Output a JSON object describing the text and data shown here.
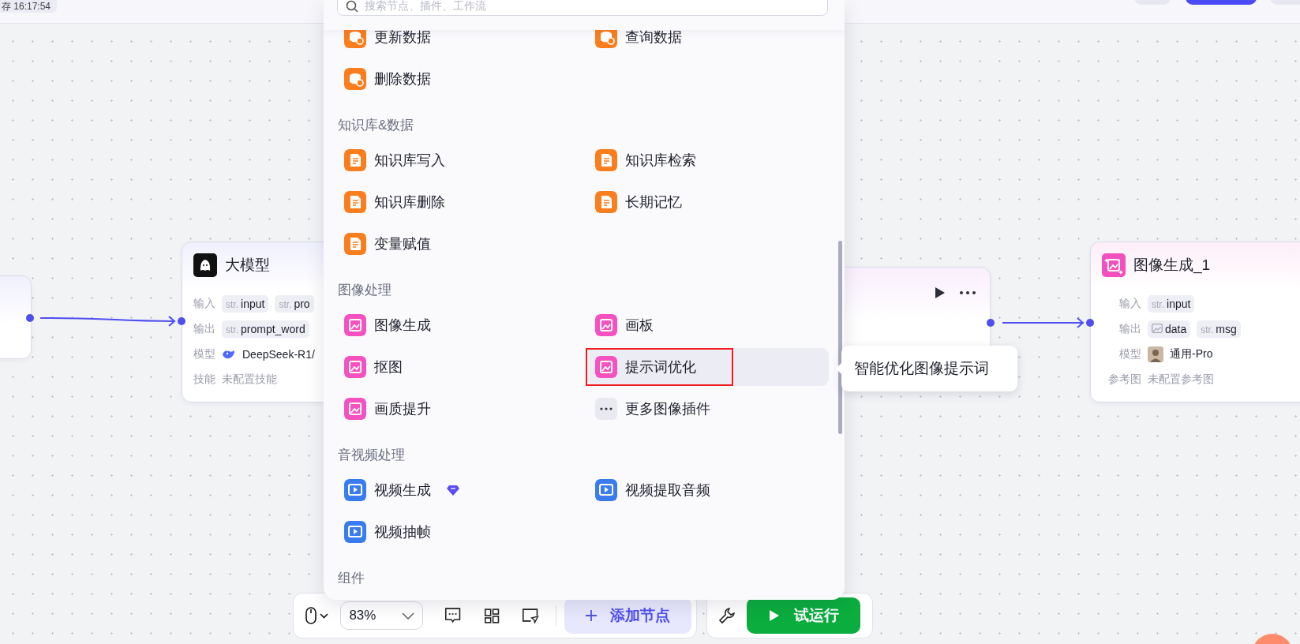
{
  "header": {
    "save_status": "存 16:17:54"
  },
  "canvas": {
    "nodes": [
      {
        "kind": "partial"
      },
      {
        "kind": "llm",
        "title": "大模型",
        "rows": [
          {
            "kind": "tags",
            "label": "输入",
            "tags": [
              {
                "kind": "str",
                "prefix": "str.",
                "text": "input"
              },
              {
                "kind": "str",
                "prefix": "str.",
                "text": "pro"
              }
            ]
          },
          {
            "kind": "tags",
            "label": "输出",
            "tags": [
              {
                "kind": "str",
                "prefix": "str.",
                "text": "prompt_word"
              }
            ]
          },
          {
            "kind": "model",
            "label": "模型",
            "value": "DeepSeek-R1/"
          },
          {
            "kind": "empty",
            "label": "技能",
            "value": "未配置技能"
          }
        ]
      },
      {
        "kind": "plugin"
      },
      {
        "kind": "image",
        "title": "图像生成_1",
        "rows": [
          {
            "kind": "tags",
            "label": "输入",
            "tags": [
              {
                "kind": "str",
                "prefix": "str.",
                "text": "input"
              }
            ]
          },
          {
            "kind": "tags",
            "label": "输出",
            "tags": [
              {
                "kind": "image",
                "text": "data"
              },
              {
                "kind": "str",
                "prefix": "str.",
                "text": "msg"
              }
            ]
          },
          {
            "kind": "model",
            "label": "模型",
            "value": "通用-Pro"
          },
          {
            "kind": "empty",
            "label": "参考图",
            "value": "未配置参考图"
          }
        ]
      }
    ]
  },
  "popup": {
    "search": {
      "placeholder": "搜索节点、插件、工作流"
    },
    "sections": [
      {
        "items": [
          {
            "label": "更新数据",
            "kind": "plugin",
            "color": "#fa7d1e",
            "selected": false,
            "marked": false,
            "premium": false
          },
          {
            "label": "查询数据",
            "kind": "plugin",
            "color": "#fa7d1e",
            "selected": false,
            "marked": false,
            "premium": false
          },
          {
            "label": "删除数据",
            "kind": "plugin",
            "color": "#fa7d1e",
            "selected": false,
            "marked": false,
            "premium": false
          }
        ]
      },
      {
        "title": "知识库&数据",
        "items": [
          {
            "label": "知识库写入",
            "kind": "plugin",
            "color": "#fa7d1e",
            "selected": false,
            "marked": false,
            "premium": false
          },
          {
            "label": "知识库检索",
            "kind": "plugin",
            "color": "#fa7d1e",
            "selected": false,
            "marked": false,
            "premium": false
          },
          {
            "label": "知识库删除",
            "kind": "plugin",
            "color": "#fa7d1e",
            "selected": false,
            "marked": false,
            "premium": false
          },
          {
            "label": "长期记忆",
            "kind": "plugin",
            "color": "#fa7d1e",
            "selected": false,
            "marked": false,
            "premium": false
          },
          {
            "label": "变量赋值",
            "kind": "plugin",
            "color": "#fa7d1e",
            "selected": false,
            "marked": false,
            "premium": false
          }
        ]
      },
      {
        "title": "图像处理",
        "items": [
          {
            "label": "图像生成",
            "kind": "plugin",
            "color": "#f551c1",
            "selected": false,
            "marked": false,
            "premium": false
          },
          {
            "label": "画板",
            "kind": "plugin",
            "color": "#f551c1",
            "selected": false,
            "marked": false,
            "premium": false
          },
          {
            "label": "抠图",
            "kind": "plugin",
            "color": "#f551c1",
            "selected": false,
            "marked": false,
            "premium": false
          },
          {
            "label": "提示词优化",
            "kind": "plugin",
            "color": "#f551c1",
            "selected": true,
            "marked": true,
            "premium": false
          },
          {
            "label": "画质提升",
            "kind": "plugin",
            "color": "#f551c1",
            "selected": false,
            "marked": false,
            "premium": false
          },
          {
            "label": "更多图像插件",
            "kind": "more",
            "selected": false,
            "marked": false,
            "premium": false
          }
        ]
      },
      {
        "title": "音视频处理",
        "items": [
          {
            "label": "视频生成",
            "kind": "plugin",
            "color": "#3a7cf0",
            "selected": false,
            "marked": false,
            "premium": true
          },
          {
            "label": "视频提取音频",
            "kind": "plugin",
            "color": "#3a7cf0",
            "selected": false,
            "marked": false,
            "premium": false
          },
          {
            "label": "视频抽帧",
            "kind": "plugin",
            "color": "#3a7cf0",
            "selected": false,
            "marked": false,
            "premium": false
          }
        ]
      },
      {
        "title": "组件"
      }
    ]
  },
  "tooltip": {
    "text": "智能优化图像提示词"
  },
  "toolbar": {
    "zoom": "83%",
    "add_node": "添加节点",
    "run": "试运行"
  }
}
